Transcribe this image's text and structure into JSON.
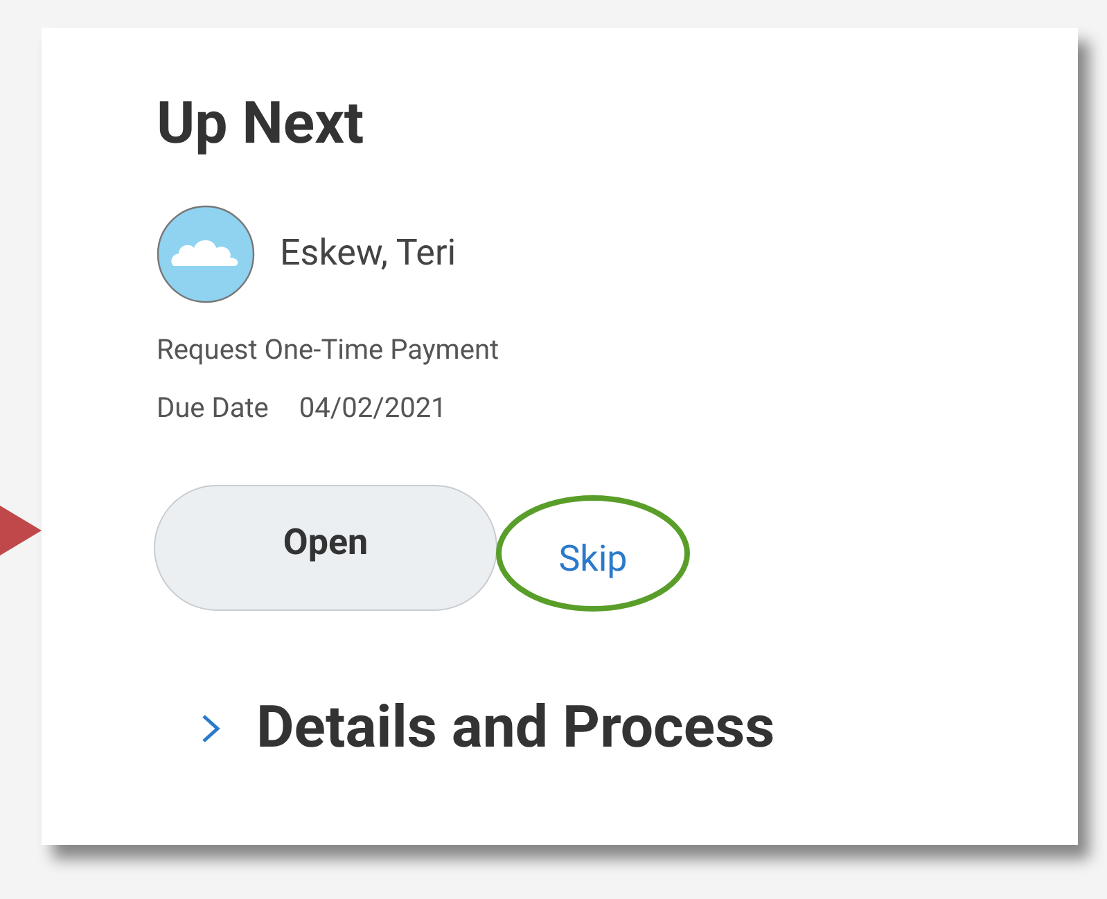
{
  "card": {
    "title": "Up Next",
    "person": {
      "name": "Eskew, Teri"
    },
    "task": "Request One-Time Payment",
    "due_label": "Due Date",
    "due_date": "04/02/2021",
    "buttons": [
      {
        "label": "Open",
        "kind": "primary"
      },
      {
        "label": "Skip",
        "kind": "link"
      }
    ],
    "section": {
      "label": "Details and Process",
      "expanded": false
    }
  }
}
